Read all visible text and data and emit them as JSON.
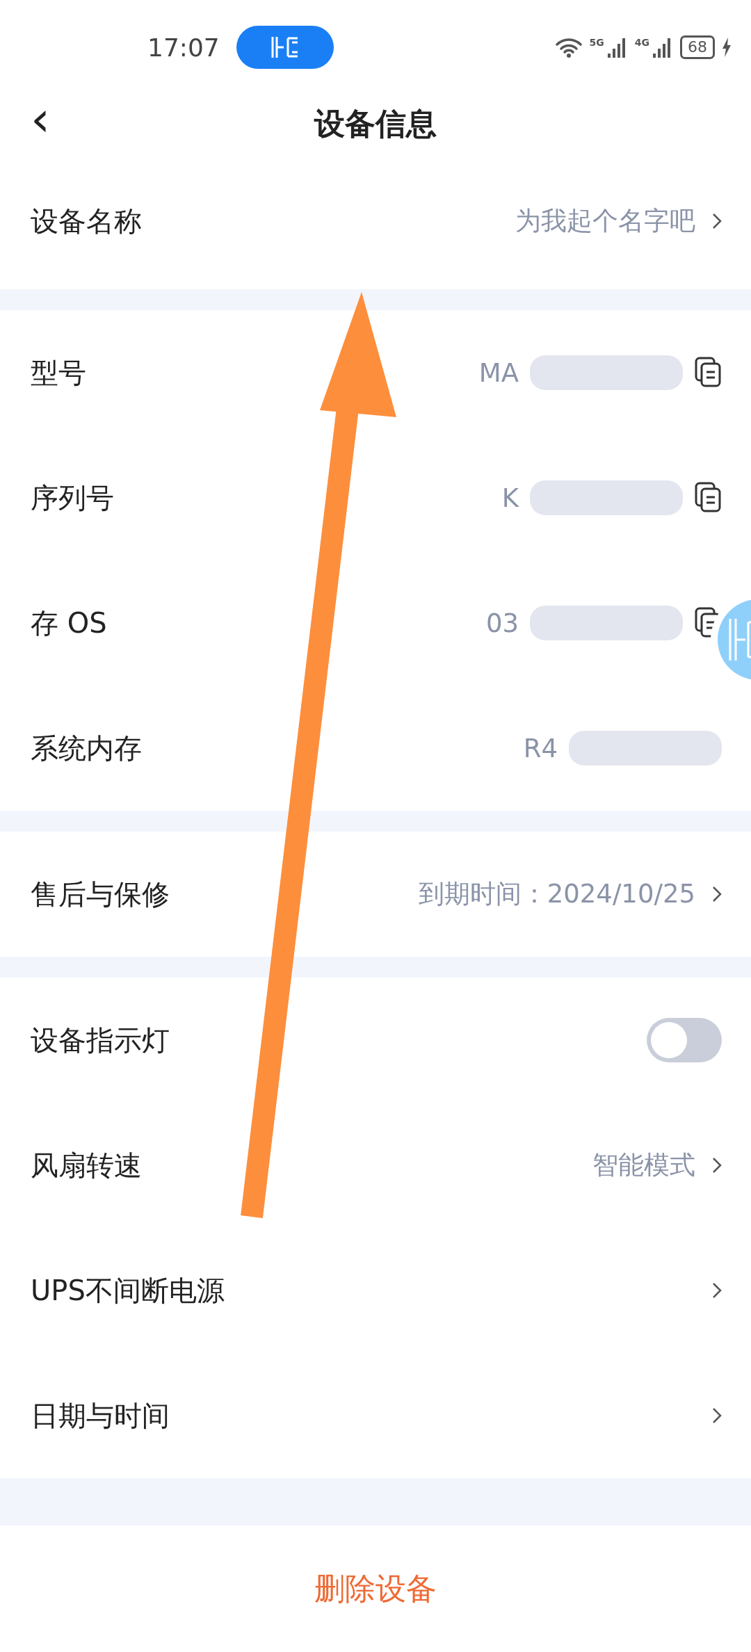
{
  "status_bar": {
    "time": "17:07",
    "networks": [
      "5G",
      "4G"
    ],
    "battery": "68"
  },
  "header": {
    "back": "‹",
    "title": "设备信息"
  },
  "sections": [
    {
      "rows": [
        {
          "kind": "link",
          "label": "设备名称",
          "value": "为我起个名字吧"
        }
      ]
    },
    {
      "rows": [
        {
          "kind": "copy",
          "label": "型号",
          "value": "MA"
        },
        {
          "kind": "copy",
          "label": "序列号",
          "value": "K"
        },
        {
          "kind": "copy",
          "label": "存 OS",
          "value": "03"
        },
        {
          "kind": "plain",
          "label": "系统内存",
          "value": "R4"
        }
      ]
    },
    {
      "rows": [
        {
          "kind": "link",
          "label": "售后与保修",
          "value": "到期时间：2024/10/25"
        }
      ]
    },
    {
      "rows": [
        {
          "kind": "toggle",
          "label": "设备指示灯",
          "on": false
        },
        {
          "kind": "link",
          "label": "风扇转速",
          "value": "智能模式"
        },
        {
          "kind": "link",
          "label": "UPS不间断电源"
        },
        {
          "kind": "link",
          "label": "日期与时间"
        }
      ]
    }
  ],
  "delete_button": "删除设备"
}
